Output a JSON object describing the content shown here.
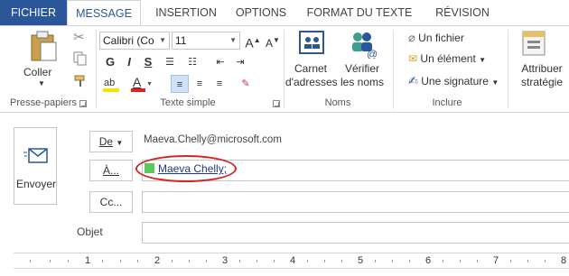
{
  "ribbon_tabs": [
    {
      "label": "FICHIER"
    },
    {
      "label": "MESSAGE"
    },
    {
      "label": "INSERTION"
    },
    {
      "label": "OPTIONS"
    },
    {
      "label": "FORMAT DU TEXTE"
    },
    {
      "label": "RÉVISION"
    }
  ],
  "clipboard": {
    "paste_label": "Coller",
    "group_label": "Presse-papiers"
  },
  "basic_text": {
    "font_name": "Calibri (Co",
    "font_size": "11",
    "grow_label": "A",
    "shrink_label": "A",
    "bold": "G",
    "italic": "I",
    "underline": "S",
    "group_label": "Texte simple"
  },
  "names": {
    "address_book_label": "Carnet\nd'adresses",
    "check_names_label": "Vérifier\nles noms",
    "group_label": "Noms"
  },
  "include": {
    "attach_file": "Un fichier",
    "attach_item": "Un élément",
    "signature": "Une signature",
    "group_label": "Inclure"
  },
  "assign_policy": {
    "label": "Attribuer\nstratégie"
  },
  "compose": {
    "send_label": "Envoyer",
    "from_button": "De",
    "from_value": "Maeva.Chelly@microsoft.com",
    "to_button": "À...",
    "to_recipient": "Maeva Chelly;",
    "cc_button": "Cc...",
    "subject_label": "Objet"
  },
  "ruler_numbers": [
    "1",
    "2",
    "3",
    "4",
    "5",
    "6",
    "7",
    "8"
  ],
  "colors": {
    "accent": "#2b579a",
    "highlight_circle": "#d42424",
    "presence_green": "#5ec65e",
    "font_color_red": "#e02020",
    "highlight_yellow": "#f5e400"
  }
}
